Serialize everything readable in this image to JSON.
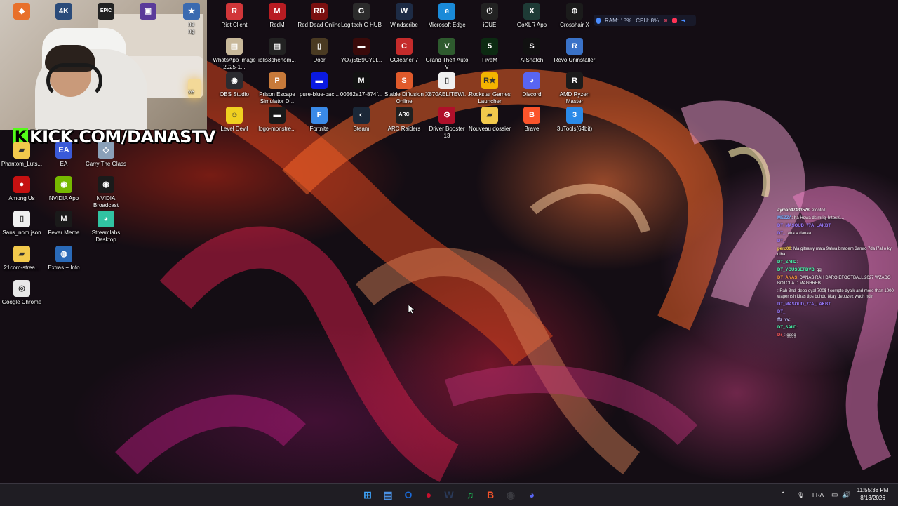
{
  "desktop": {
    "icons": [
      {
        "label": "",
        "icon": "orange-app-icon",
        "color": "#e8702a",
        "glyph": "◆"
      },
      {
        "label": "",
        "icon": "4k-video-icon",
        "color": "#2a4b7a",
        "glyph": "4K"
      },
      {
        "label": "",
        "icon": "epic-games-icon",
        "color": "#222222",
        "glyph": "EPIC"
      },
      {
        "label": "",
        "icon": "chip-app-icon",
        "color": "#5a3a9a",
        "glyph": "▣"
      },
      {
        "label": "",
        "icon": "game-shortcut-icon",
        "color": "#3a6ab0",
        "glyph": "★"
      },
      {
        "label": "Riot Client",
        "icon": "riot-client-icon",
        "color": "#d13639",
        "glyph": "R"
      },
      {
        "label": "RedM",
        "icon": "redm-icon",
        "color": "#b81c22",
        "glyph": "M"
      },
      {
        "label": "Red Dead Online",
        "icon": "red-dead-icon",
        "color": "#7a1010",
        "glyph": "RD"
      },
      {
        "label": "Logitech G HUB",
        "icon": "logitech-icon",
        "color": "#2b2b2b",
        "glyph": "G"
      },
      {
        "label": "Windscribe",
        "icon": "windscribe-icon",
        "color": "#1d2b45",
        "glyph": "W"
      },
      {
        "label": "Microsoft Edge",
        "icon": "edge-icon",
        "color": "#1a8ad8",
        "glyph": "e"
      },
      {
        "label": "iCUE",
        "icon": "icue-icon",
        "color": "#222222",
        "glyph": "⏻"
      },
      {
        "label": "GoXLR App",
        "icon": "goxlr-icon",
        "color": "#1e3b36",
        "glyph": "X"
      },
      {
        "label": "Crosshair X",
        "icon": "crosshair-icon",
        "color": "#1b1b1b",
        "glyph": "⊕"
      },
      {
        "label": "WhatsApp Image 2025-1...",
        "icon": "image-file-icon",
        "color": "#c8b89a",
        "glyph": "▤"
      },
      {
        "label": "iblis3phenom...",
        "icon": "image-file-icon",
        "color": "#222222",
        "glyph": "▤"
      },
      {
        "label": "Door",
        "icon": "door-icon",
        "color": "#4a3a22",
        "glyph": "▯"
      },
      {
        "label": "YO7j5tB9CY0I...",
        "icon": "image-file-icon",
        "color": "#3a0a0a",
        "glyph": "▬"
      },
      {
        "label": "CCleaner 7",
        "icon": "ccleaner-icon",
        "color": "#c52b2b",
        "glyph": "C"
      },
      {
        "label": "Grand Theft Auto V",
        "icon": "gta-icon",
        "color": "#2e5a2e",
        "glyph": "V"
      },
      {
        "label": "FiveM",
        "icon": "fivem-icon",
        "color": "#0c2a12",
        "glyph": "5"
      },
      {
        "label": "AISnatch",
        "icon": "aisnatch-icon",
        "color": "#111111",
        "glyph": "S"
      },
      {
        "label": "Revo Uninstaller",
        "icon": "revo-icon",
        "color": "#3a72c8",
        "glyph": "R"
      },
      {
        "label": "OBS Studio",
        "icon": "obs-icon",
        "color": "#2b2b30",
        "glyph": "◉"
      },
      {
        "label": "Prison Escape Simulator D...",
        "icon": "prison-escape-icon",
        "color": "#c87a3a",
        "glyph": "P"
      },
      {
        "label": "pure-blue-bac...",
        "icon": "image-file-icon",
        "color": "#0a1ae0",
        "glyph": "▬"
      },
      {
        "label": "00562a17-874f...",
        "icon": "monster-image-icon",
        "color": "#111111",
        "glyph": "M"
      },
      {
        "label": "Stable Diffusion Online",
        "icon": "stable-diffusion-icon",
        "color": "#e05a2b",
        "glyph": "S"
      },
      {
        "label": "X870AELITEWI...",
        "icon": "document-icon",
        "color": "#f0f0f0",
        "glyph": "▯"
      },
      {
        "label": "Rockstar Games Launcher",
        "icon": "rockstar-icon",
        "color": "#f4b400",
        "glyph": "R★"
      },
      {
        "label": "Discord",
        "icon": "discord-icon",
        "color": "#5865f2",
        "glyph": "◕"
      },
      {
        "label": "AMD Ryzen Master",
        "icon": "ryzen-icon",
        "color": "#1b1b1b",
        "glyph": "R"
      },
      {
        "label": "Level Devil",
        "icon": "level-devil-icon",
        "color": "#f0d020",
        "glyph": "☺"
      },
      {
        "label": "logo-monstre...",
        "icon": "image-file-icon",
        "color": "#1a1a1a",
        "glyph": "▬"
      },
      {
        "label": "Fortnite",
        "icon": "fortnite-icon",
        "color": "#3a8ae8",
        "glyph": "F"
      },
      {
        "label": "Steam",
        "icon": "steam-icon",
        "color": "#1b2838",
        "glyph": "◐"
      },
      {
        "label": "ARC Raiders",
        "icon": "arc-raiders-icon",
        "color": "#202020",
        "glyph": "ARC"
      },
      {
        "label": "Driver Booster 13",
        "icon": "driver-booster-icon",
        "color": "#b0102a",
        "glyph": "⚙"
      },
      {
        "label": "Nouveau dossier",
        "icon": "folder-icon",
        "color": "#f2c94c",
        "glyph": "▰"
      },
      {
        "label": "Brave",
        "icon": "brave-icon",
        "color": "#fb542b",
        "glyph": "B"
      },
      {
        "label": "3uTools(64bit)",
        "icon": "3utools-icon",
        "color": "#2a8ae8",
        "glyph": "3"
      },
      {
        "label": "Phantom_Luts...",
        "icon": "folder-icon",
        "color": "#f2c94c",
        "glyph": "▰"
      },
      {
        "label": "EA",
        "icon": "ea-icon",
        "color": "#3a5ad8",
        "glyph": "EA"
      },
      {
        "label": "Carry The Glass",
        "icon": "carry-glass-icon",
        "color": "#8aa0b8",
        "glyph": "◇"
      },
      {
        "label": "Among Us",
        "icon": "among-us-icon",
        "color": "#c51111",
        "glyph": "●"
      },
      {
        "label": "NVIDIA App",
        "icon": "nvidia-icon",
        "color": "#76b900",
        "glyph": "◉"
      },
      {
        "label": "NVIDIA Broadcast",
        "icon": "nvidia-broadcast-icon",
        "color": "#1a1a1a",
        "glyph": "◉"
      },
      {
        "label": "Sans_nom.json",
        "icon": "document-icon",
        "color": "#f0f0f0",
        "glyph": "▯"
      },
      {
        "label": "Fever Meme",
        "icon": "fever-meme-icon",
        "color": "#1a1a1a",
        "glyph": "M"
      },
      {
        "label": "Streamlabs Desktop",
        "icon": "streamlabs-icon",
        "color": "#31c3a2",
        "glyph": "◕"
      },
      {
        "label": "21com-strea...",
        "icon": "folder-icon",
        "color": "#f2c94c",
        "glyph": "▰"
      },
      {
        "label": "Extras + Info",
        "icon": "extras-info-icon",
        "color": "#2a6ab8",
        "glyph": "◍"
      },
      {
        "label": "Google Chrome",
        "icon": "chrome-icon",
        "color": "#e8e8e8",
        "glyph": "◎"
      },
      {
        "label": "ne\nng",
        "icon": "partial-icon",
        "color": "transparent",
        "glyph": ""
      },
      {
        "label": "ve",
        "icon": "partial-icon",
        "color": "transparent",
        "glyph": ""
      }
    ]
  },
  "stream_overlay": {
    "kick_logo_letter": "K",
    "kick_url": "KICK.COM/DANASTV"
  },
  "perf_overlay": {
    "ram": "RAM: 18%",
    "cpu": "CPU: 8%"
  },
  "chat": [
    {
      "user": "ayman47433578",
      "text": ": efootoll",
      "color": "#ffffff"
    },
    {
      "user": "MEZZA",
      "text": ": ha Howa ds mrigl https://...",
      "color": "#7ab0ff"
    },
    {
      "user": "DT_MASOUD_77A_LAKBT",
      "text": "",
      "color": "#9a7aff"
    },
    {
      "user": "DT_",
      "text": ": ana a danaa",
      "color": "#9a7aff"
    },
    {
      "user": "DT_",
      "text": ":",
      "color": "#9a7aff"
    },
    {
      "user": "pero00",
      "text": ": Ma gitsawy mata 9alwa bnadem 3amro 7da l7al o ky diha",
      "color": "#ffd84a"
    },
    {
      "user": "DT_SAIID",
      "text": ":",
      "color": "#4affb0"
    },
    {
      "user": "DT_YOUSSEFBVB",
      "text": ": gg",
      "color": "#4affb0"
    },
    {
      "user": "DT_ANAS",
      "text": ": DANAS RAH DARO EFOOTBALL 2027 WZADO BOTOLA D MAGHREB",
      "color": "#ff9a3a"
    },
    {
      "user": "",
      "text": ": Rah 3ndi depo dyal 700$ f compte dyalk and more than 1000 wager rsh khas tips bohdo 8kay depozez wach ndir",
      "color": "#ff5a5a"
    },
    {
      "user": "DT_MASOUD_77A_LAKBT",
      "text": "",
      "color": "#9a7aff"
    },
    {
      "user": "DT_",
      "text": "",
      "color": "#9a7aff"
    },
    {
      "user": "ffz_vv",
      "text": ": ",
      "color": "#c0c0ff"
    },
    {
      "user": "DT_SAIID",
      "text": ":",
      "color": "#4affb0"
    },
    {
      "user": "Dr_",
      "text": ": gggg",
      "color": "#ff5a5a"
    }
  ],
  "taskbar": {
    "apps": [
      {
        "icon": "windows-start-icon",
        "glyph": "⊞",
        "color": "#3ea6ff"
      },
      {
        "icon": "file-explorer-icon",
        "glyph": "▤",
        "color": "#4a90e2"
      },
      {
        "icon": "outlook-icon",
        "glyph": "O",
        "color": "#1a6ad8"
      },
      {
        "icon": "record-app-icon",
        "glyph": "●",
        "color": "#c8102e"
      },
      {
        "icon": "windscribe-icon",
        "glyph": "W",
        "color": "#2a3a5a"
      },
      {
        "icon": "spotify-icon",
        "glyph": "♫",
        "color": "#1db954"
      },
      {
        "icon": "brave-icon",
        "glyph": "B",
        "color": "#fb542b"
      },
      {
        "icon": "obs-icon",
        "glyph": "◉",
        "color": "#3a3a40"
      },
      {
        "icon": "discord-icon",
        "glyph": "◕",
        "color": "#5865f2"
      }
    ],
    "language": "FRA",
    "time": "11:55:38 PM",
    "date": "8/13/2026"
  }
}
